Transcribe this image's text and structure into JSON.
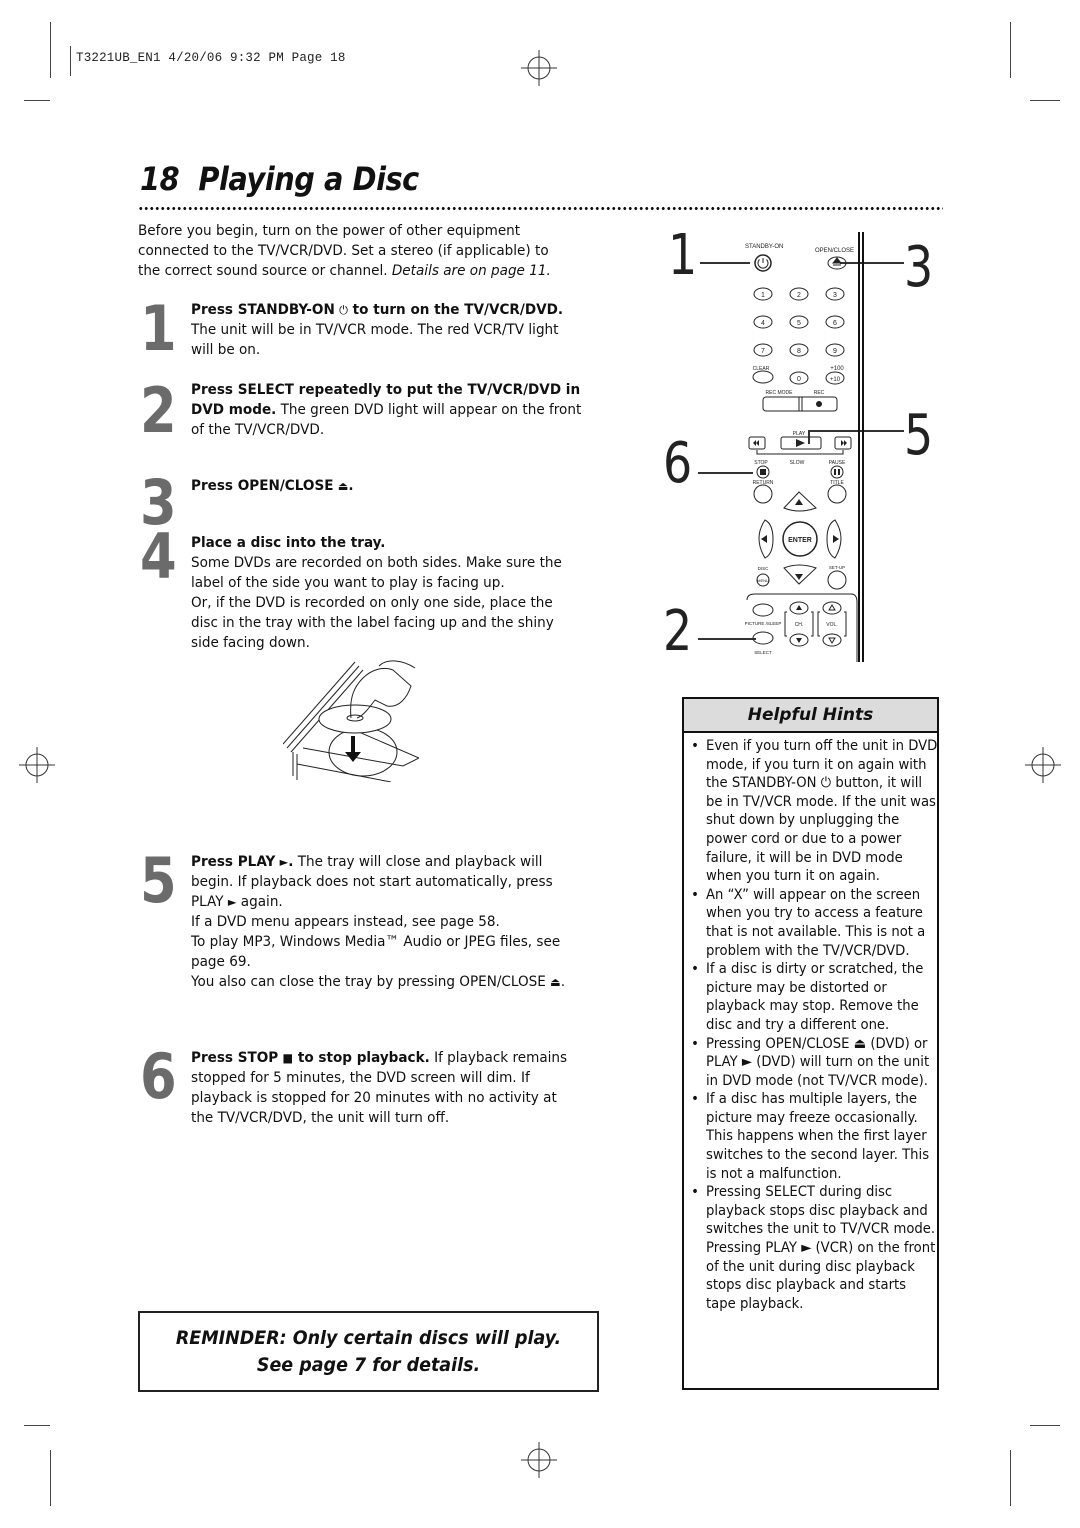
{
  "print_slug": "T3221UB_EN1  4/20/06  9:32 PM  Page 18",
  "page": {
    "number": "18",
    "title": "Playing a Disc"
  },
  "intro": {
    "text": "Before you begin, turn on the power of other equipment connected to the TV/VCR/DVD. Set a stereo (if applicable) to the correct sound source or channel. ",
    "ref": "Details are on page 11."
  },
  "steps": [
    {
      "num": "1",
      "bold": "Press STANDBY-ON",
      "icon": "power-icon",
      "bold2": " to turn on the TV/VCR/DVD.",
      "text": " The unit will be in TV/VCR mode. The red VCR/TV light will be on."
    },
    {
      "num": "2",
      "bold": "Press SELECT repeatedly to put the TV/VCR/DVD in DVD mode.",
      "text": " The green DVD light will appear on the front of the TV/VCR/DVD."
    },
    {
      "num": "3",
      "bold": "Press OPEN/CLOSE",
      "icon": "eject-icon",
      "bold2": "."
    },
    {
      "num": "4",
      "bold": "Place a disc into the tray.",
      "lines": [
        "Some DVDs are recorded on both sides. Make sure the label of the side you want to play is facing up.",
        "Or, if the DVD is recorded on only one side, place the disc in the tray with the label facing up and the shiny side facing down."
      ]
    },
    {
      "num": "5",
      "bold": "Press PLAY",
      "icon": "play-icon",
      "bold2": ".",
      "text": " The tray will close and playback will begin. If playback does not start automatically, press PLAY",
      "text_after": " again.",
      "lines": [
        "If a DVD menu appears instead, see page 58.",
        "To play MP3, Windows Media™ Audio or JPEG files, see page 69.",
        "You also can close the tray by pressing OPEN/CLOSE"
      ]
    },
    {
      "num": "6",
      "bold": "Press STOP",
      "icon": "stop-icon",
      "bold2": " to stop playback.",
      "text": " If playback remains stopped for 5 minutes, the DVD screen will dim. If playback is stopped for 20 minutes with no activity at the TV/VCR/DVD, the unit will turn off."
    }
  ],
  "remote": {
    "callouts": [
      "1",
      "3",
      "5",
      "6",
      "2"
    ],
    "labels": {
      "standby": "STANDBY-ON",
      "open_close": "OPEN/CLOSE",
      "digits": [
        "1",
        "2",
        "3",
        "4",
        "5",
        "6",
        "7",
        "8",
        "9",
        "0"
      ],
      "clear": "CLEAR",
      "plus100": "+100",
      "plus10": "+10",
      "rec_mode": "REC MODE",
      "rec": "REC",
      "play": "PLAY",
      "stop": "STOP",
      "slow": "SLOW",
      "pause": "PAUSE",
      "return": "RETURN",
      "title": "TITLE",
      "enter": "ENTER",
      "disc": "DISC",
      "menu": "MENU",
      "setup": "SET-UP",
      "picture_sleep": "PICTURE /SLEEP",
      "ch": "CH.",
      "vol": "VOL.",
      "select": "SELECT"
    }
  },
  "hints": {
    "title": "Helpful Hints",
    "items": [
      "Even if you turn off the unit in DVD mode, if you turn it on again with the STANDBY-ON ⏻ button, it will be in TV/VCR mode. If the unit was shut down by unplugging the power cord or due to a power failure, it will be in DVD mode when you turn it on again.",
      "An “X” will appear on the screen when you try to access a feature that is not available. This is not a problem with the TV/VCR/DVD.",
      "If a disc is dirty or scratched, the picture may be distorted or playback may stop. Remove the disc and try a different one.",
      "Pressing OPEN/CLOSE ⏏ (DVD) or PLAY ► (DVD) will turn on the unit in DVD mode (not TV/VCR mode).",
      "If a disc has multiple layers, the picture may freeze occasionally. This happens when the first layer switches to the second layer. This is not a malfunction.",
      "Pressing SELECT during disc playback stops disc playback and switches the unit to TV/VCR mode. Pressing PLAY ► (VCR) on the front of the unit during disc playback stops disc playback and starts tape playback."
    ]
  },
  "reminder": {
    "line1": "REMINDER: Only certain discs will play.",
    "line2": "See page 7 for details."
  },
  "glyphs": {
    "power": "⏻",
    "eject": "⏏",
    "play": "►",
    "stop": "■"
  }
}
